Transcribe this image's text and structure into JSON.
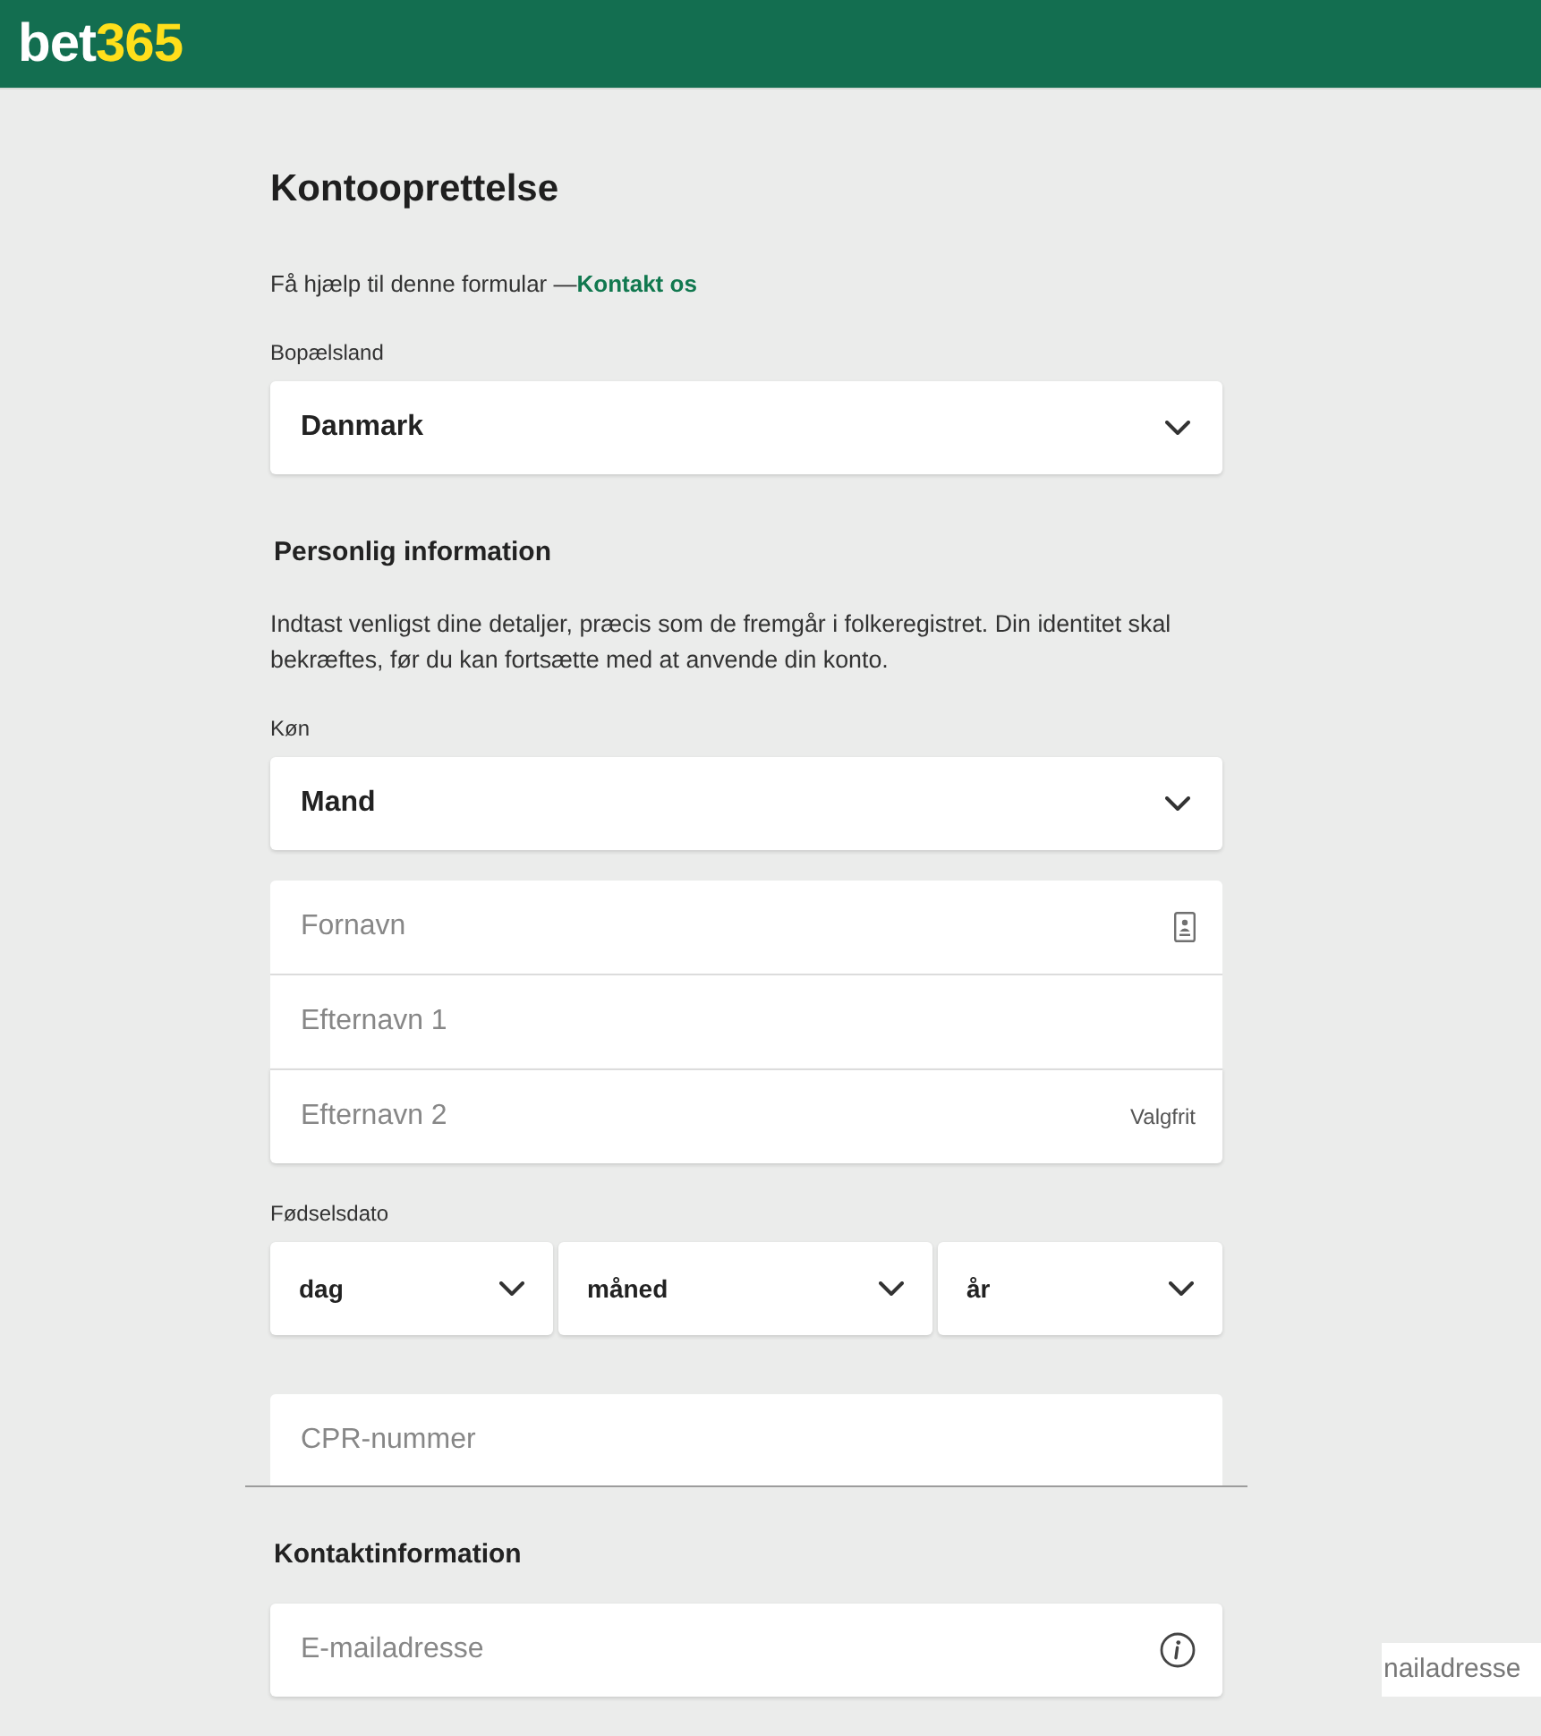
{
  "header": {
    "logo": {
      "part_1": "bet",
      "part_2": "365"
    }
  },
  "form": {
    "title": "Kontooprettelse",
    "help": {
      "text": "Få hjælp til denne formular —",
      "link": "Kontakt os"
    },
    "country": {
      "label": "Bopælsland",
      "value": "Danmark"
    },
    "personal": {
      "heading": "Personlig information",
      "description": "Indtast venligst dine detaljer, præcis som de fremgår i folkeregistret. Din identitet skal bekræftes, før du kan fortsætte med at anvende din konto.",
      "gender": {
        "label": "Køn",
        "value": "Mand"
      },
      "name_fields": [
        {
          "kind": "autofill",
          "placeholder": "Fornavn"
        },
        {
          "kind": "plain",
          "placeholder": "Efternavn 1"
        },
        {
          "kind": "optional",
          "placeholder": "Efternavn 2",
          "note": "Valgfrit"
        }
      ],
      "birth_date": {
        "label": "Fødselsdato",
        "parts": [
          {
            "value": "dag"
          },
          {
            "value": "måned"
          },
          {
            "value": "år"
          }
        ]
      },
      "cpr": {
        "placeholder": "CPR-nummer"
      }
    },
    "contact": {
      "heading": "Kontaktinformation",
      "email": {
        "kind": "info",
        "placeholder": "E-mailadresse"
      }
    }
  },
  "fragment": {
    "text": "nailadresse"
  }
}
